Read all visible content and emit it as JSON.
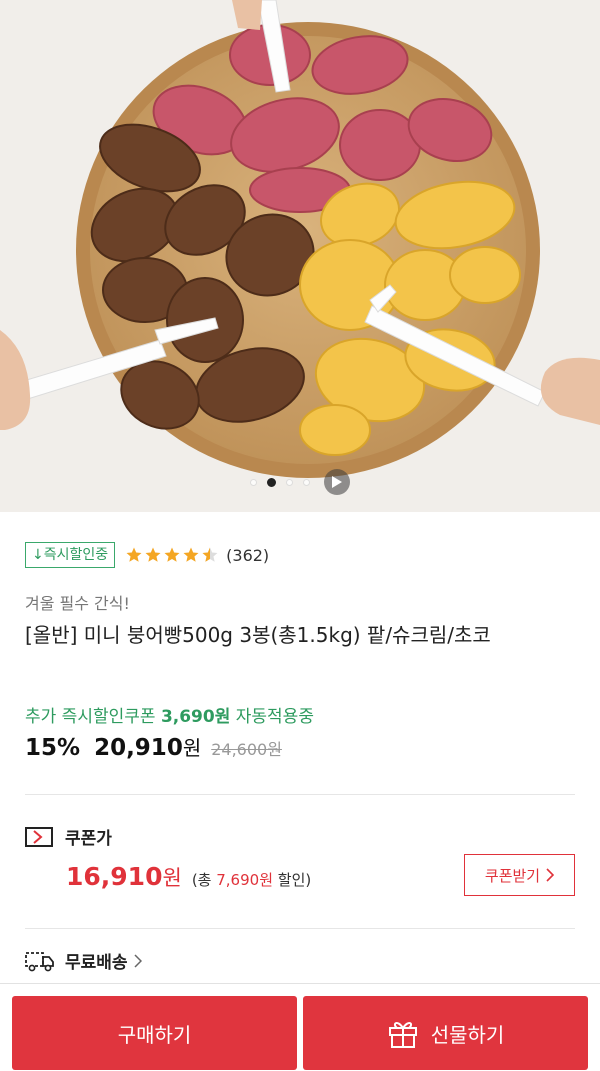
{
  "gallery": {
    "image_alt": "",
    "slide_count": 4,
    "active_slide": 2
  },
  "product": {
    "cert_badge": "↓즉시할인중",
    "rating": 4.5,
    "review_count": "(362)",
    "subtitle": "겨울 필수 간식!",
    "title": "[올반] 미니 붕어빵500g 3봉(총1.5kg) 팥/슈크림/초코",
    "coupon_auto_prefix": "추가 즉시할인쿠폰",
    "coupon_auto_amount": "3,690원",
    "coupon_auto_suffix": "자동적용중",
    "discount_rate": "15%",
    "price": "20,910",
    "price_unit": "원",
    "original_price": "24,600원"
  },
  "coupon": {
    "label": "쿠폰가",
    "price": "16,910",
    "price_unit": "원",
    "total_prefix": "(총",
    "total_amount": "7,690원",
    "total_suffix": "할인)",
    "button_label": "쿠폰받기"
  },
  "shipping": {
    "label": "무료배송"
  },
  "bottom_bar": {
    "buy_label": "구매하기",
    "gift_label": "선물하기"
  },
  "colors": {
    "accent_red": "#e0353e",
    "accent_green": "#2e9b5f",
    "star": "#f4a623"
  },
  "icons": {
    "coupon": "coupon-tag-icon",
    "shipping": "truck-icon",
    "gift": "gift-icon",
    "play": "play-icon",
    "star": "star-icon"
  }
}
